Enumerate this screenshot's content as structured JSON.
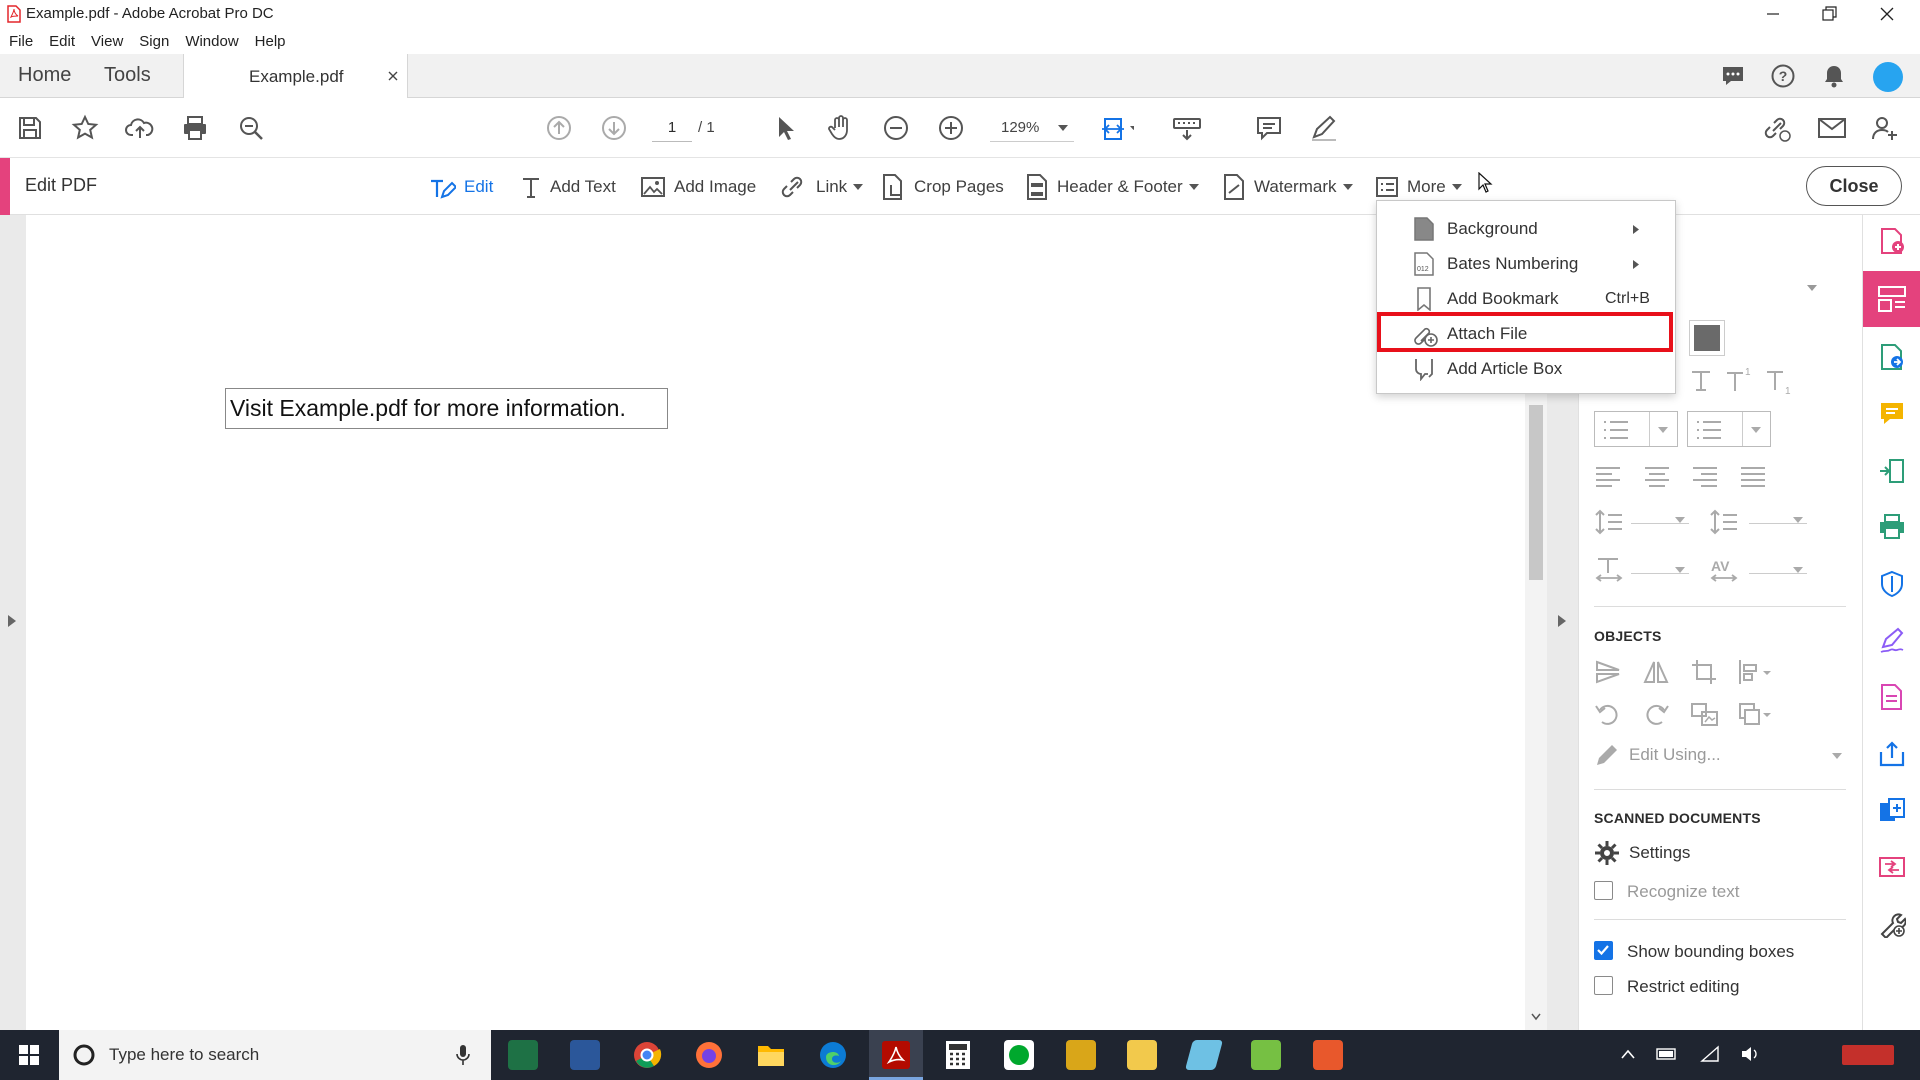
{
  "window": {
    "title": "Example.pdf - Adobe Acrobat Pro DC"
  },
  "menu": [
    "File",
    "Edit",
    "View",
    "Sign",
    "Window",
    "Help"
  ],
  "tabs": {
    "home": "Home",
    "tools": "Tools",
    "document": "Example.pdf"
  },
  "toolbar": {
    "page_current": "1",
    "page_total": "/ 1",
    "zoom": "129%"
  },
  "editbar": {
    "title": "Edit PDF",
    "edit": "Edit",
    "add_text": "Add Text",
    "add_image": "Add Image",
    "link": "Link",
    "crop_pages": "Crop Pages",
    "header_footer": "Header & Footer",
    "watermark": "Watermark",
    "more": "More",
    "close": "Close"
  },
  "document": {
    "text": "Visit Example.pdf for more information."
  },
  "more_menu": {
    "items": [
      {
        "label": "Background",
        "submenu": true
      },
      {
        "label": "Bates Numbering",
        "submenu": true
      },
      {
        "label": "Add Bookmark",
        "shortcut": "Ctrl+B"
      },
      {
        "label": "Attach File",
        "highlighted": true
      },
      {
        "label": "Add Article Box"
      }
    ]
  },
  "panel": {
    "objects_header": "OBJECTS",
    "edit_using": "Edit Using...",
    "scanned_header": "SCANNED DOCUMENTS",
    "settings": "Settings",
    "recognize_text": "Recognize text",
    "show_bounding_boxes": "Show bounding boxes",
    "restrict_editing": "Restrict editing",
    "checkboxes": {
      "recognize_text": false,
      "show_bounding_boxes": true,
      "restrict_editing": false
    }
  },
  "taskbar": {
    "search_placeholder": "Type here to search"
  },
  "colors": {
    "accent_pink": "#e4427d",
    "accent_blue": "#1473e6",
    "highlight_red": "#e8101a",
    "taskbar": "#1f2530"
  }
}
